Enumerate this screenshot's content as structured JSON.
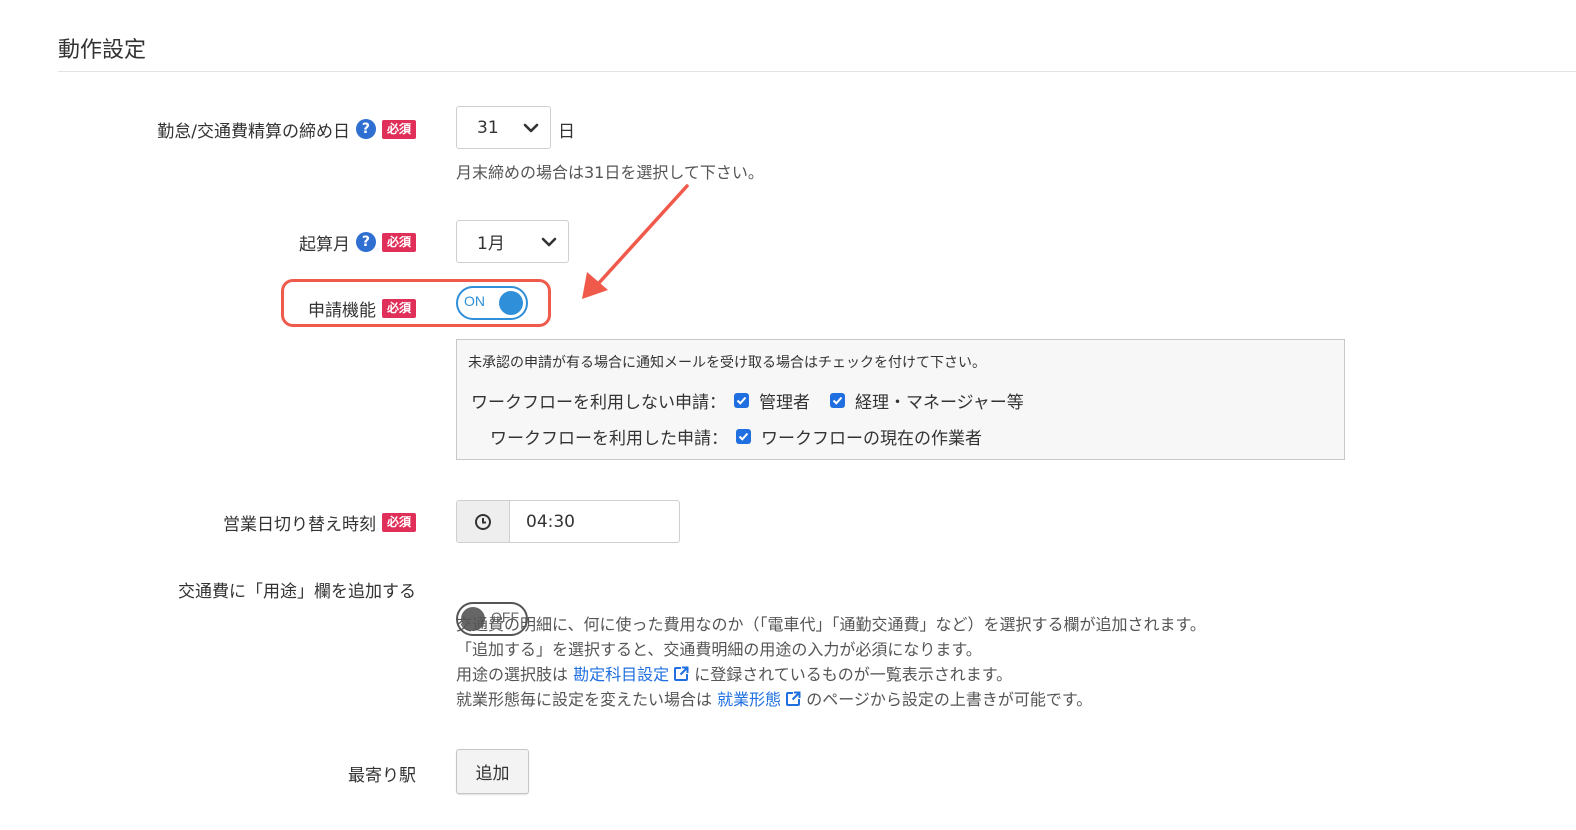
{
  "section": {
    "title": "動作設定"
  },
  "closing_day": {
    "label": "勤怠/交通費精算の締め日",
    "required_badge": "必須",
    "value": "31",
    "unit": "日",
    "hint": "月末締めの場合は31日を選択して下さい。"
  },
  "start_month": {
    "label": "起算月",
    "required_badge": "必須",
    "value": "1月"
  },
  "application_feature": {
    "label": "申請機能",
    "required_badge": "必須",
    "toggle_text": "ON",
    "state": "on"
  },
  "notification": {
    "intro": "未承認の申請が有る場合に通知メールを受け取る場合はチェックを付けて下さい。",
    "row1_label": "ワークフローを利用しない申請：",
    "row1_option1": "管理者",
    "row1_option2": "経理・マネージャー等",
    "row2_label": "ワークフローを利用した申請：",
    "row2_option1": "ワークフローの現在の作業者"
  },
  "business_day_switch": {
    "label": "営業日切り替え時刻",
    "required_badge": "必須",
    "value": "04:30"
  },
  "purpose_column": {
    "label": "交通費に「用途」欄を追加する",
    "toggle_text": "OFF",
    "state": "off",
    "desc_line1": "交通費の明細に、何に使った費用なのか（「電車代」「通勤交通費」など）を選択する欄が追加されます。",
    "desc_line2": "「追加する」を選択すると、交通費明細の用途の入力が必須になります。",
    "desc_line3_pre": "用途の選択肢は ",
    "desc_line3_link": "勘定科目設定",
    "desc_line3_post": " に登録されているものが一覧表示されます。",
    "desc_line4_pre": "就業形態毎に設定を変えたい場合は ",
    "desc_line4_link": "就業形態",
    "desc_line4_post": " のページから設定の上書きが可能です。"
  },
  "nearest_station": {
    "label": "最寄り駅",
    "add_button": "追加"
  },
  "colors": {
    "accent_blue": "#2f8fd8",
    "required_red": "#e0305a",
    "highlight_red": "#f05a4b",
    "link_blue": "#1f6fe0"
  }
}
